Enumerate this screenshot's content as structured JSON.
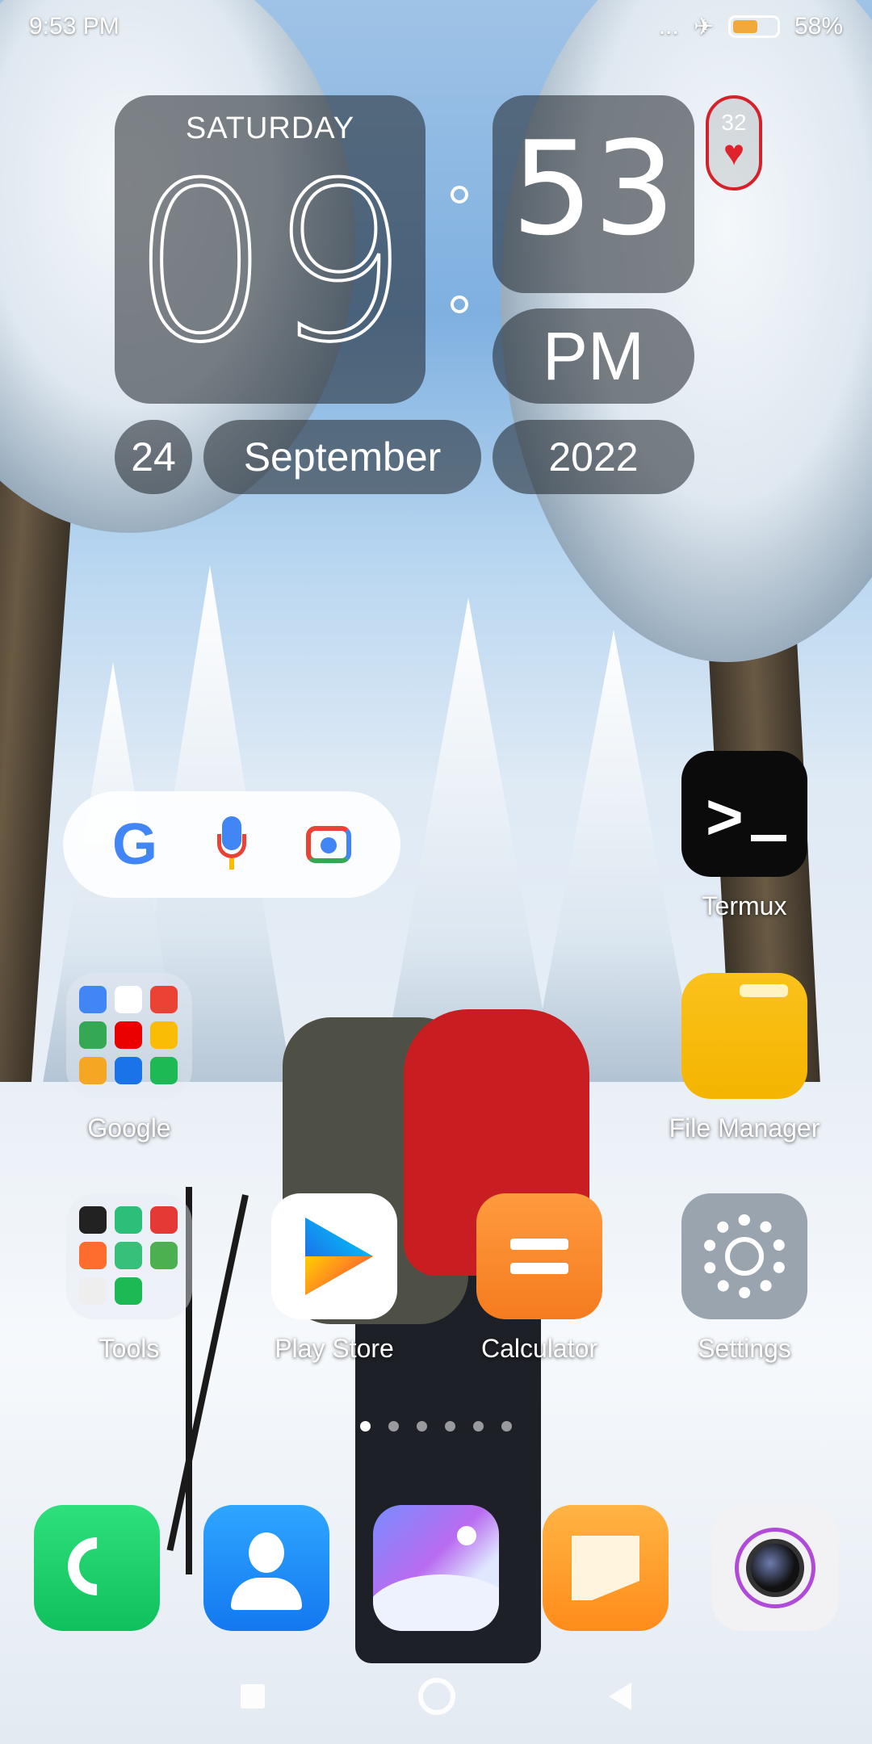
{
  "status_bar": {
    "time": "9:53 PM",
    "more": "...",
    "airplane": "✈",
    "battery_percent": "58%",
    "battery_level": 0.58
  },
  "clock_widget": {
    "day": "SATURDAY",
    "hour": "09",
    "minute": "53",
    "ampm": "PM",
    "date_day": "24",
    "month": "September",
    "year": "2022"
  },
  "heart_widget": {
    "value": "32",
    "icon": "♥"
  },
  "search_bar": {
    "google_logo": "G",
    "mic_icon": "mic-icon",
    "lens_icon": "camera-lens-icon"
  },
  "apps": {
    "termux": "Termux",
    "file_manager": "File Manager",
    "google_folder": "Google",
    "tools_folder": "Tools",
    "play_store": "Play Store",
    "calculator": "Calculator",
    "settings": "Settings"
  },
  "google_folder_colors": [
    "#4285f4",
    "#ffffff",
    "#ea4335",
    "#34a853",
    "#ea0000",
    "#fbbc05",
    "#f5a623",
    "#1a73e8",
    "#1db954"
  ],
  "tools_folder_colors": [
    "#222222",
    "#2bbf7a",
    "#e53935",
    "#ff6d2e",
    "#36c07a",
    "#4caf50",
    "#eeeeee",
    "#1db954"
  ],
  "page_indicator": {
    "pages": 6,
    "active_index": 0
  },
  "dock": [
    "phone",
    "contacts",
    "gallery",
    "messages",
    "camera"
  ],
  "colors": {
    "heart_red": "#d6202a",
    "widget_bg": "rgba(30,34,40,.55)",
    "battery_fill": "#f0a93a"
  }
}
